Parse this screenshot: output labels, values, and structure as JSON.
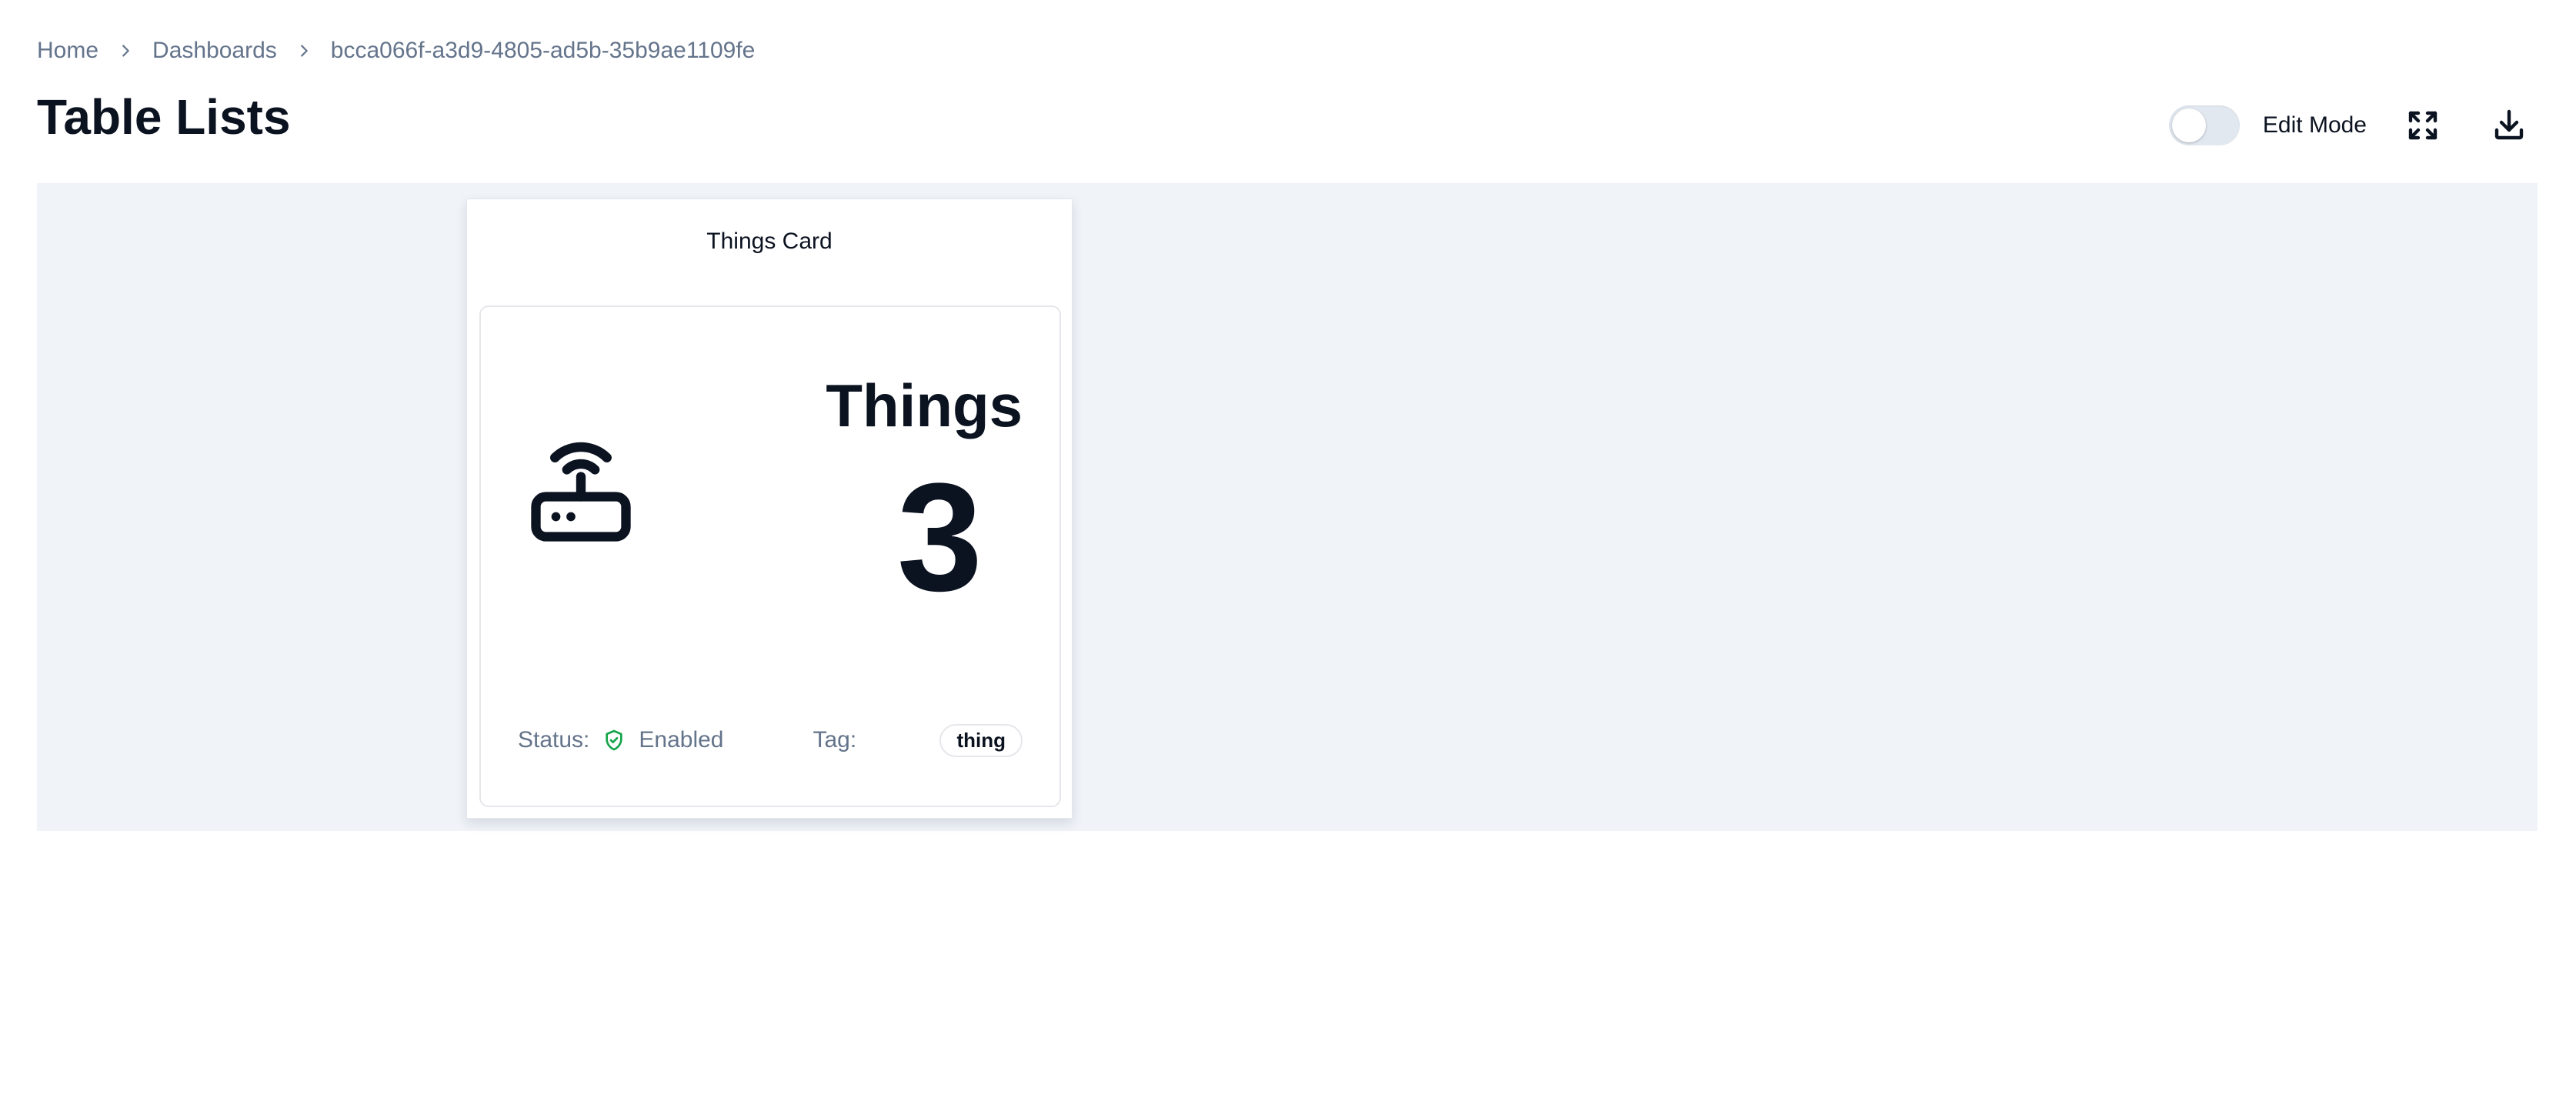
{
  "breadcrumb": {
    "items": [
      "Home",
      "Dashboards",
      "bcca066f-a3d9-4805-ad5b-35b9ae1109fe"
    ]
  },
  "header": {
    "title": "Table Lists"
  },
  "toolbar": {
    "edit_mode_label": "Edit Mode",
    "edit_mode_on": false,
    "icons": [
      "expand-icon",
      "download-icon"
    ]
  },
  "widget": {
    "title": "Things Card",
    "icon": "router-icon",
    "metric_label": "Things",
    "metric_value": "3",
    "status_label": "Status:",
    "status_icon": "shield-check-icon",
    "status_value": "Enabled",
    "tag_label": "Tag:",
    "tag_value": "thing"
  },
  "colors": {
    "canvas_bg": "#f0f4f9",
    "status_accent": "#16a34a",
    "text_muted": "#64748b",
    "text_primary": "#0b1220"
  }
}
